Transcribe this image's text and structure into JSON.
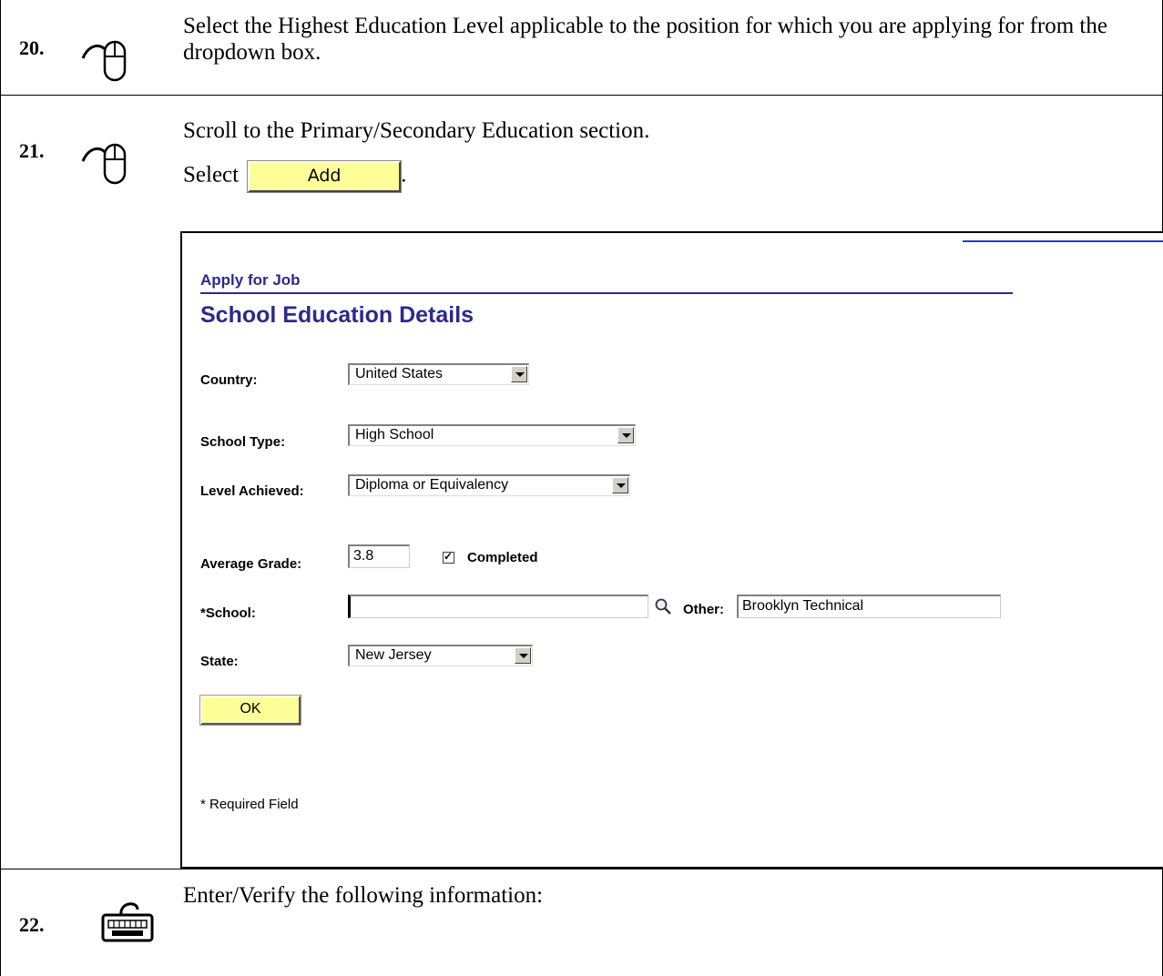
{
  "steps": [
    {
      "number": "20.",
      "icon": "mouse-icon",
      "text": "Select the Highest Education Level applicable to the position for which you are applying for from the dropdown box."
    },
    {
      "number": "21.",
      "icon": "mouse-icon",
      "line1": "Scroll to the Primary/Secondary Education section.",
      "select_prefix": "Select",
      "button_label": "Add",
      "suffix": "."
    },
    {
      "number": "22.",
      "icon": "keyboard-icon",
      "text": "Enter/Verify the following information:"
    }
  ],
  "screenshot": {
    "breadcrumb": "Apply for Job",
    "title": "School Education Details",
    "fields": {
      "country": {
        "label": "Country:",
        "value": "United States"
      },
      "school_type": {
        "label": "School Type:",
        "value": "High School"
      },
      "level_achieved": {
        "label": "Level Achieved:",
        "value": "Diploma or Equivalency"
      },
      "average_grade": {
        "label": "Average Grade:",
        "value": "3.8"
      },
      "completed": {
        "label": "Completed",
        "checked": true,
        "mark": "✓"
      },
      "school": {
        "label": "*School:",
        "value": ""
      },
      "other": {
        "label": "Other:",
        "value": "Brooklyn Technical"
      },
      "state": {
        "label": "State:",
        "value": "New Jersey"
      }
    },
    "ok_label": "OK",
    "required_note": "* Required Field"
  },
  "colors": {
    "button_bg": "#ffff99",
    "heading": "#2c2a8a"
  }
}
